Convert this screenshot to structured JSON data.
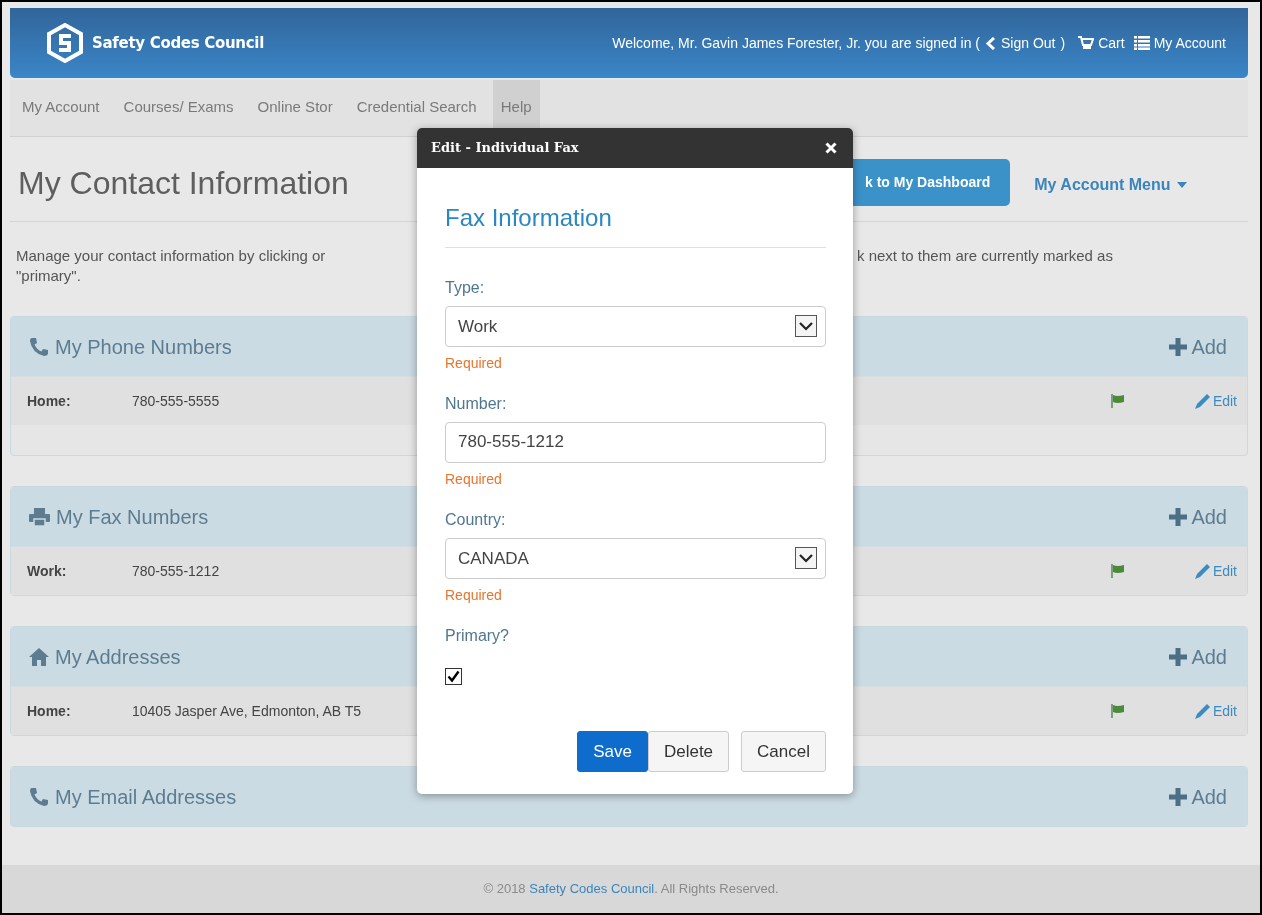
{
  "header": {
    "logo": "Safety Codes Council",
    "welcome": "Welcome, Mr. Gavin James Forester, Jr. you are signed in (",
    "sign_out": "Sign Out",
    "close_paren": ")",
    "cart": "Cart",
    "account": "My Account"
  },
  "nav": [
    {
      "label": "My Account",
      "selected": false
    },
    {
      "label": "Courses/ Exams",
      "selected": false
    },
    {
      "label": "Online Stor",
      "selected": false
    },
    {
      "label": "Credential Search",
      "selected": false
    },
    {
      "label": "Help",
      "selected": true
    }
  ],
  "page": {
    "title": "My Contact Information",
    "dashboard_button": "k to My Dashboard",
    "menu": "My Account Menu",
    "intro_left": "Manage your contact information by clicking or",
    "intro_right": "k next to them are currently marked as",
    "intro_line2": "\"primary\"."
  },
  "panels": [
    {
      "kind": "phone",
      "title": "My Phone Numbers",
      "add": "Add",
      "rows": [
        {
          "label": "Home:",
          "value": "780-555-5555",
          "primary": true,
          "edit": "Edit"
        }
      ]
    },
    {
      "kind": "fax",
      "title": "My Fax Numbers",
      "add": "Add",
      "rows": [
        {
          "label": "Work:",
          "value": "780-555-1212",
          "primary": true,
          "edit": "Edit"
        }
      ]
    },
    {
      "kind": "home",
      "title": "My Addresses",
      "add": "Add",
      "rows": [
        {
          "label": "Home:",
          "value": "10405 Jasper Ave, Edmonton, AB T5",
          "primary": true,
          "edit": "Edit"
        }
      ]
    },
    {
      "kind": "phone",
      "title": "My Email Addresses",
      "add": "Add"
    }
  ],
  "modal": {
    "title": "Edit - Individual Fax",
    "heading": "Fax Information",
    "fields": [
      {
        "kind": "select",
        "label": "Type:",
        "value": "Work",
        "error": "Required"
      },
      {
        "kind": "text",
        "label": "Number:",
        "value": "780-555-1212",
        "error": "Required"
      },
      {
        "kind": "select",
        "label": "Country:",
        "value": "CANADA",
        "error": "Required"
      },
      {
        "kind": "checkbox",
        "label": "Primary?",
        "checked": true
      }
    ],
    "buttons": [
      {
        "label": "Save",
        "primary": true
      },
      {
        "label": "Delete",
        "primary": false
      },
      {
        "label": "Cancel",
        "primary": false
      }
    ]
  },
  "footer": {
    "before": "© 2018 ",
    "link": "Safety Codes Council",
    "after": ". All Rights Reserved."
  }
}
